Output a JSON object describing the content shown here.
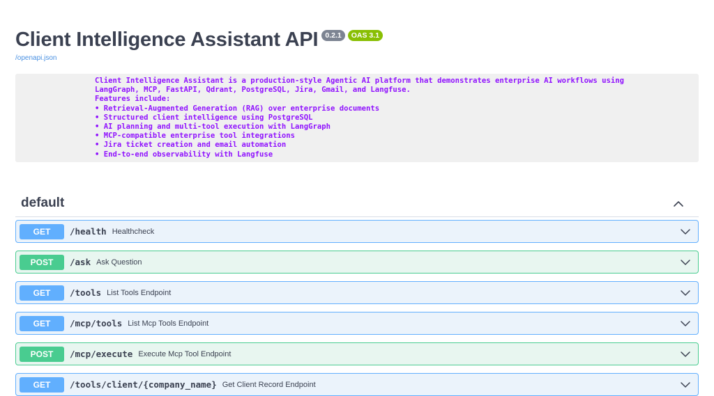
{
  "header": {
    "title": "Client Intelligence Assistant API",
    "version_badge": "0.2.1",
    "oas_badge": "OAS 3.1",
    "spec_link": "/openapi.json"
  },
  "description": {
    "lines": [
      "Client Intelligence Assistant is a production-style Agentic AI platform that demonstrates enterprise AI workflows using",
      "LangGraph, MCP, FastAPI, Qdrant, PostgreSQL, Jira, Gmail, and Langfuse.",
      "Features include:",
      "• Retrieval-Augmented Generation (RAG) over enterprise documents",
      "• Structured client intelligence using PostgreSQL",
      "• AI planning and multi-tool execution with LangGraph",
      "• MCP-compatible enterprise tool integrations",
      "• Jira ticket creation and email automation",
      "• End-to-end observability with Langfuse"
    ]
  },
  "section": {
    "title": "default",
    "collapse_icon": "chevron-up-icon"
  },
  "operations": [
    {
      "method": "GET",
      "path": "/health",
      "summary": "Healthcheck",
      "expand_icon": "chevron-down-icon"
    },
    {
      "method": "POST",
      "path": "/ask",
      "summary": "Ask Question",
      "expand_icon": "chevron-down-icon"
    },
    {
      "method": "GET",
      "path": "/tools",
      "summary": "List Tools Endpoint",
      "expand_icon": "chevron-down-icon"
    },
    {
      "method": "GET",
      "path": "/mcp/tools",
      "summary": "List Mcp Tools Endpoint",
      "expand_icon": "chevron-down-icon"
    },
    {
      "method": "POST",
      "path": "/mcp/execute",
      "summary": "Execute Mcp Tool Endpoint",
      "expand_icon": "chevron-down-icon"
    },
    {
      "method": "GET",
      "path": "/tools/client/{company_name}",
      "summary": "Get Client Record Endpoint",
      "expand_icon": "chevron-down-icon"
    }
  ],
  "colors": {
    "get": "#61affe",
    "post": "#49cc90",
    "description_text": "#9012fe",
    "version_badge": "#7d8492",
    "oas_badge": "#89bf04"
  }
}
